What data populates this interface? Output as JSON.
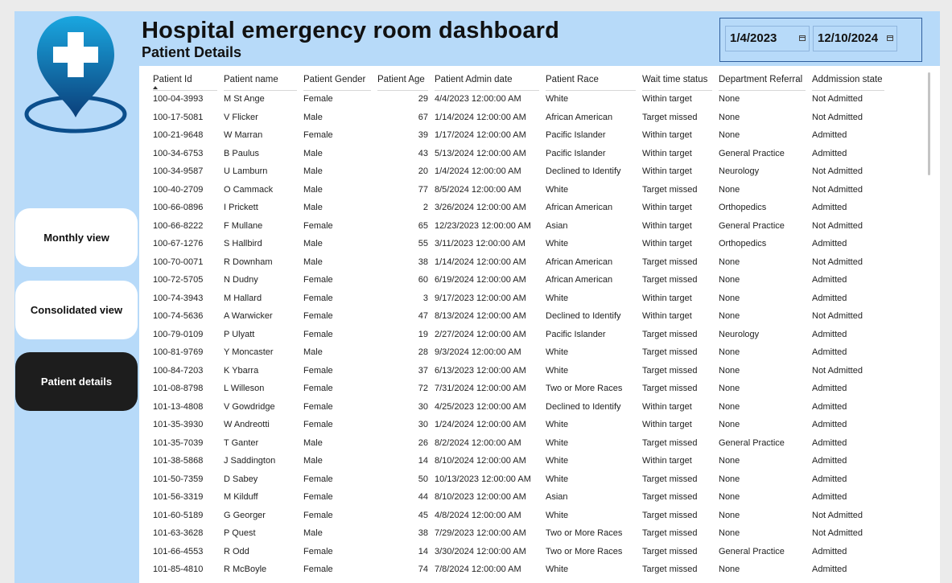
{
  "header": {
    "title": "Hospital emergency room dashboard",
    "subtitle": "Patient Details",
    "date_start": "1/4/2023",
    "date_end": "12/10/2024"
  },
  "nav": {
    "monthly": "Monthly view",
    "consolidated": "Consolidated view",
    "patient_details": "Patient details"
  },
  "colors": {
    "panel_blue": "#b7daf9",
    "active_button": "#1d1d1d",
    "logo_blue_light": "#1aa7e0",
    "logo_blue_dark": "#0b3f7a"
  },
  "icons": {
    "logo": "location-pin-cross-icon"
  },
  "table": {
    "columns": [
      "Patient Id",
      "Patient name",
      "Patient Gender",
      "Patient Age",
      "Patient Admin date",
      "Patient Race",
      "Wait time status",
      "Department Referral",
      "Addmission state"
    ],
    "rows": [
      [
        "100-04-3993",
        "M St Ange",
        "Female",
        "29",
        "4/4/2023 12:00:00 AM",
        "White",
        "Within target",
        "None",
        "Not Admitted"
      ],
      [
        "100-17-5081",
        "V Flicker",
        "Male",
        "67",
        "1/14/2024 12:00:00 AM",
        "African American",
        "Target missed",
        "None",
        "Not Admitted"
      ],
      [
        "100-21-9648",
        "W Marran",
        "Female",
        "39",
        "1/17/2024 12:00:00 AM",
        "Pacific Islander",
        "Within target",
        "None",
        "Admitted"
      ],
      [
        "100-34-6753",
        "B Paulus",
        "Male",
        "43",
        "5/13/2024 12:00:00 AM",
        "Pacific Islander",
        "Within target",
        "General Practice",
        "Admitted"
      ],
      [
        "100-34-9587",
        "U Lamburn",
        "Male",
        "20",
        "1/4/2024 12:00:00 AM",
        "Declined to Identify",
        "Within target",
        "Neurology",
        "Not Admitted"
      ],
      [
        "100-40-2709",
        "O Cammack",
        "Male",
        "77",
        "8/5/2024 12:00:00 AM",
        "White",
        "Target missed",
        "None",
        "Not Admitted"
      ],
      [
        "100-66-0896",
        "I Prickett",
        "Male",
        "2",
        "3/26/2024 12:00:00 AM",
        "African American",
        "Within target",
        "Orthopedics",
        "Admitted"
      ],
      [
        "100-66-8222",
        "F Mullane",
        "Female",
        "65",
        "12/23/2023 12:00:00 AM",
        "Asian",
        "Within target",
        "General Practice",
        "Not Admitted"
      ],
      [
        "100-67-1276",
        "S Hallbird",
        "Male",
        "55",
        "3/11/2023 12:00:00 AM",
        "White",
        "Within target",
        "Orthopedics",
        "Admitted"
      ],
      [
        "100-70-0071",
        "R Downham",
        "Male",
        "38",
        "1/14/2024 12:00:00 AM",
        "African American",
        "Target missed",
        "None",
        "Not Admitted"
      ],
      [
        "100-72-5705",
        "N Dudny",
        "Female",
        "60",
        "6/19/2024 12:00:00 AM",
        "African American",
        "Target missed",
        "None",
        "Admitted"
      ],
      [
        "100-74-3943",
        "M Hallard",
        "Female",
        "3",
        "9/17/2023 12:00:00 AM",
        "White",
        "Within target",
        "None",
        "Admitted"
      ],
      [
        "100-74-5636",
        "A Warwicker",
        "Female",
        "47",
        "8/13/2024 12:00:00 AM",
        "Declined to Identify",
        "Within target",
        "None",
        "Not Admitted"
      ],
      [
        "100-79-0109",
        "P Ulyatt",
        "Female",
        "19",
        "2/27/2024 12:00:00 AM",
        "Pacific Islander",
        "Target missed",
        "Neurology",
        "Admitted"
      ],
      [
        "100-81-9769",
        "Y Moncaster",
        "Male",
        "28",
        "9/3/2024 12:00:00 AM",
        "White",
        "Target missed",
        "None",
        "Admitted"
      ],
      [
        "100-84-7203",
        "K Ybarra",
        "Female",
        "37",
        "6/13/2023 12:00:00 AM",
        "White",
        "Target missed",
        "None",
        "Not Admitted"
      ],
      [
        "101-08-8798",
        "L Willeson",
        "Female",
        "72",
        "7/31/2024 12:00:00 AM",
        "Two or More Races",
        "Target missed",
        "None",
        "Admitted"
      ],
      [
        "101-13-4808",
        "V Gowdridge",
        "Female",
        "30",
        "4/25/2023 12:00:00 AM",
        "Declined to Identify",
        "Within target",
        "None",
        "Admitted"
      ],
      [
        "101-35-3930",
        "W Andreotti",
        "Female",
        "30",
        "1/24/2024 12:00:00 AM",
        "White",
        "Within target",
        "None",
        "Admitted"
      ],
      [
        "101-35-7039",
        "T Ganter",
        "Male",
        "26",
        "8/2/2024 12:00:00 AM",
        "White",
        "Target missed",
        "General Practice",
        "Admitted"
      ],
      [
        "101-38-5868",
        "J Saddington",
        "Male",
        "14",
        "8/10/2024 12:00:00 AM",
        "White",
        "Within target",
        "None",
        "Admitted"
      ],
      [
        "101-50-7359",
        "D Sabey",
        "Female",
        "50",
        "10/13/2023 12:00:00 AM",
        "White",
        "Target missed",
        "None",
        "Admitted"
      ],
      [
        "101-56-3319",
        "M Kilduff",
        "Female",
        "44",
        "8/10/2023 12:00:00 AM",
        "Asian",
        "Target missed",
        "None",
        "Admitted"
      ],
      [
        "101-60-5189",
        "G Georger",
        "Female",
        "45",
        "4/8/2024 12:00:00 AM",
        "White",
        "Target missed",
        "None",
        "Not Admitted"
      ],
      [
        "101-63-3628",
        "P Quest",
        "Male",
        "38",
        "7/29/2023 12:00:00 AM",
        "Two or More Races",
        "Target missed",
        "None",
        "Not Admitted"
      ],
      [
        "101-66-4553",
        "R Odd",
        "Female",
        "14",
        "3/30/2024 12:00:00 AM",
        "Two or More Races",
        "Target missed",
        "General Practice",
        "Admitted"
      ],
      [
        "101-85-4810",
        "R McBoyle",
        "Female",
        "74",
        "7/8/2024 12:00:00 AM",
        "White",
        "Target missed",
        "None",
        "Admitted"
      ]
    ]
  }
}
